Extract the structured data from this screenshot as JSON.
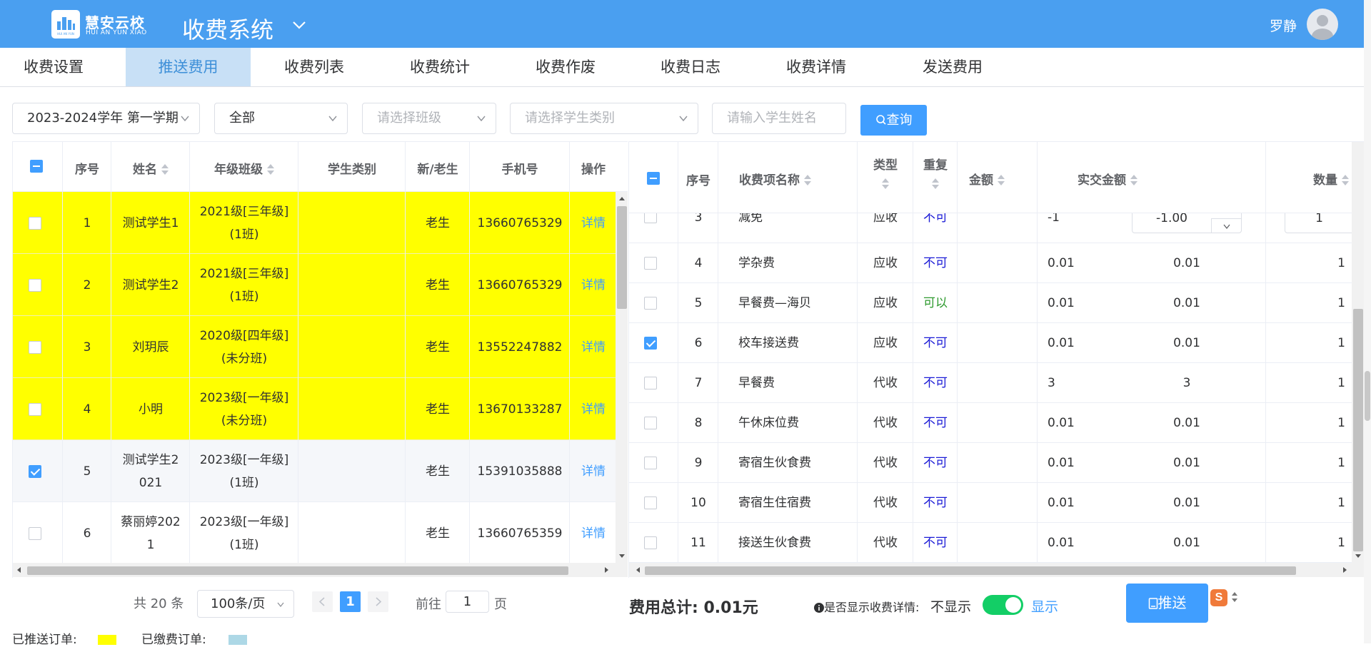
{
  "header": {
    "logo_cn": "慧安云校",
    "logo_en": "HUI AN YUN XIAO",
    "logo_caption": "HUI AN YUN",
    "system_title": "收费系统",
    "user_name": "罗静"
  },
  "tabs": [
    {
      "label": "收费设置"
    },
    {
      "label": "推送费用",
      "active": true
    },
    {
      "label": "收费列表"
    },
    {
      "label": "收费统计"
    },
    {
      "label": "收费作废"
    },
    {
      "label": "收费日志"
    },
    {
      "label": "收费详情"
    },
    {
      "label": "发送费用"
    }
  ],
  "filters": {
    "term": "2023-2024学年 第一学期",
    "scope": "全部",
    "class_placeholder": "请选择班级",
    "type_placeholder": "请选择学生类别",
    "name_placeholder": "请输入学生姓名",
    "query_label": "查询"
  },
  "students": {
    "columns": [
      "序号",
      "姓名",
      "年级班级",
      "学生类别",
      "新/老生",
      "手机号",
      "操作"
    ],
    "rows": [
      {
        "no": "1",
        "name": "测试学生1",
        "grade1": "2021级[三年级]",
        "grade2": "(1班)",
        "category": "",
        "status": "老生",
        "phone": "13660765329",
        "op": "详情",
        "pushed": true,
        "checked": false
      },
      {
        "no": "2",
        "name": "测试学生2",
        "grade1": "2021级[三年级]",
        "grade2": "(1班)",
        "category": "",
        "status": "老生",
        "phone": "13660765329",
        "op": "详情",
        "pushed": true,
        "checked": false
      },
      {
        "no": "3",
        "name": "刘玥辰",
        "grade1": "2020级[四年级]",
        "grade2": "(未分班)",
        "category": "",
        "status": "老生",
        "phone": "13552247882",
        "op": "详情",
        "pushed": true,
        "checked": false
      },
      {
        "no": "4",
        "name": "小明",
        "grade1": "2023级[一年级]",
        "grade2": "(未分班)",
        "category": "",
        "status": "老生",
        "phone": "13670133287",
        "op": "详情",
        "pushed": true,
        "checked": false
      },
      {
        "no": "5",
        "name1": "测试学生2",
        "name2": "021",
        "grade1": "2023级[一年级]",
        "grade2": "(1班)",
        "category": "",
        "status": "老生",
        "phone": "15391035888",
        "op": "详情",
        "pushed": false,
        "checked": true
      },
      {
        "no": "6",
        "name1": "蔡丽婷202",
        "name2": "1",
        "grade1": "2023级[一年级]",
        "grade2": "(1班)",
        "category": "",
        "status": "老生",
        "phone": "13660765359",
        "op": "详情",
        "pushed": false,
        "checked": false
      }
    ]
  },
  "fees": {
    "columns": [
      "序号",
      "收费项名称",
      "类型",
      "重复",
      "金额",
      "实交金额",
      "数量"
    ],
    "partial_row": {
      "no": "3",
      "name": "减免",
      "type": "应收",
      "repeat": "不可",
      "amount": "-1",
      "paid": "-1.00",
      "qty": "1"
    },
    "rows": [
      {
        "no": "4",
        "name": "学杂费",
        "type": "应收",
        "repeat": "不可",
        "amount": "0.01",
        "paid": "0.01",
        "qty": "1",
        "checked": false
      },
      {
        "no": "5",
        "name": "早餐费—海贝",
        "type": "应收",
        "repeat": "可以",
        "amount": "0.01",
        "paid": "0.01",
        "qty": "1",
        "checked": false
      },
      {
        "no": "6",
        "name": "校车接送费",
        "type": "应收",
        "repeat": "不可",
        "amount": "0.01",
        "paid": "0.01",
        "qty": "1",
        "checked": true
      },
      {
        "no": "7",
        "name": "早餐费",
        "type": "代收",
        "repeat": "不可",
        "amount": "3",
        "paid": "3",
        "qty": "1",
        "checked": false
      },
      {
        "no": "8",
        "name": "午休床位费",
        "type": "代收",
        "repeat": "不可",
        "amount": "0.01",
        "paid": "0.01",
        "qty": "1",
        "checked": false
      },
      {
        "no": "9",
        "name": "寄宿生伙食费",
        "type": "代收",
        "repeat": "不可",
        "amount": "0.01",
        "paid": "0.01",
        "qty": "1",
        "checked": false
      },
      {
        "no": "10",
        "name": "寄宿生住宿费",
        "type": "代收",
        "repeat": "不可",
        "amount": "0.01",
        "paid": "0.01",
        "qty": "1",
        "checked": false
      },
      {
        "no": "11",
        "name": "接送生伙食费",
        "type": "代收",
        "repeat": "不可",
        "amount": "0.01",
        "paid": "0.01",
        "qty": "1",
        "checked": false
      }
    ]
  },
  "pagination": {
    "total": "共 20 条",
    "page_size": "100条/页",
    "current_page": "1",
    "goto_label": "前往",
    "goto_value": "1",
    "page_suffix": "页"
  },
  "summary": {
    "total_label": "费用总计:",
    "total_value": "0.01元",
    "detail_question": "是否显示收费详情:",
    "hide_label": "不显示",
    "show_label": "显示",
    "push_label": "推送"
  },
  "legend": {
    "pushed_label": "已推送订单:",
    "paid_label": "已缴费订单:"
  },
  "colors": {
    "header": "#4a9ff0",
    "primary": "#409eff",
    "pushed_row": "#ffff00",
    "paid_row": "#add8e6",
    "switch_on": "#13ce66"
  }
}
